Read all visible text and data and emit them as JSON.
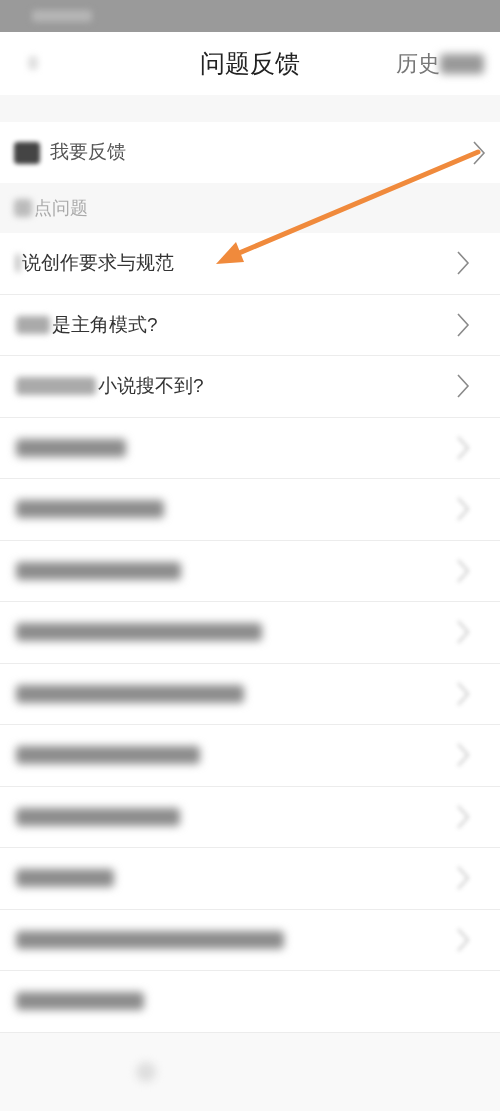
{
  "header": {
    "title": "问题反馈",
    "action": {
      "text": "历史",
      "obscured_end": true
    }
  },
  "feedback_entry": {
    "label": "我要反馈"
  },
  "section": {
    "title": "点问题",
    "obscured_start": true
  },
  "questions": [
    {
      "kind": "text",
      "text": "说创作要求与规范",
      "obscured_start": true,
      "chevron": true
    },
    {
      "kind": "text",
      "text": "是主角模式?",
      "obscured_start": true,
      "chevron": true
    },
    {
      "kind": "text",
      "text": "小说搜不到?",
      "obscured_start": true,
      "chevron": true
    },
    {
      "kind": "blurred",
      "chevron": true
    },
    {
      "kind": "blurred",
      "chevron": true
    },
    {
      "kind": "blurred",
      "chevron": true
    },
    {
      "kind": "blurred",
      "chevron": true
    },
    {
      "kind": "blurred",
      "chevron": true
    },
    {
      "kind": "blurred",
      "chevron": true
    },
    {
      "kind": "blurred",
      "chevron": true
    },
    {
      "kind": "blurred",
      "chevron": true
    },
    {
      "kind": "blurred",
      "chevron": true
    },
    {
      "kind": "blurred",
      "chevron": false
    }
  ]
}
